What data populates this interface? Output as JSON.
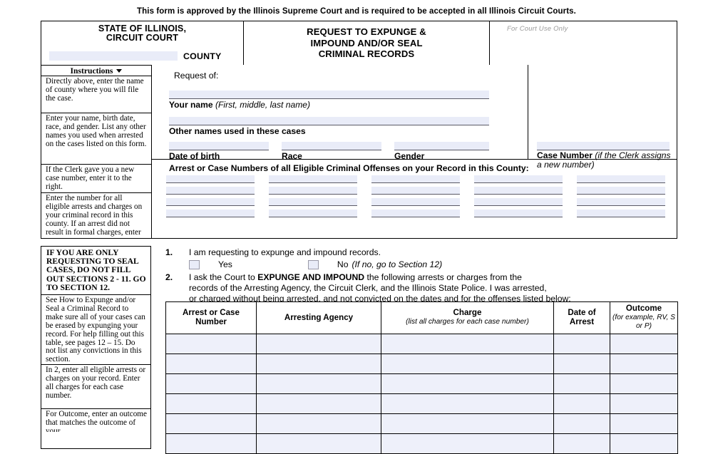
{
  "approval_notice": "This form is approved by the Illinois Supreme Court and is required to be accepted in all Illinois Circuit Courts.",
  "header": {
    "state_line1": "STATE OF ILLINOIS,",
    "state_line2": "CIRCUIT COURT",
    "county_word": "COUNTY",
    "county_value": "",
    "title_line1": "REQUEST TO EXPUNGE &",
    "title_line2": "IMPOUND AND/OR SEAL",
    "title_line3": "CRIMINAL RECORDS",
    "court_use_only": "For Court Use Only"
  },
  "instructions": {
    "heading": "Instructions",
    "items": [
      "Directly above, enter the name of county where you will file the case.",
      "Enter your name, birth date, race, and gender. List any other names you used when arrested on the cases listed on this form.",
      "If the Clerk gave you a new case number, enter it to the right.",
      "Enter the number for all eligible arrests and charges on your criminal record in this county. If an arrest did not result in formal charges, enter the arrest number."
    ]
  },
  "lower_instructions": {
    "warning": "IF YOU ARE ONLY REQUESTING TO SEAL CASES, DO NOT FILL OUT SECTIONS 2 - 11. GO TO SECTION 12.",
    "items": [
      "See How to Expunge and/or Seal a Criminal Record to make sure all of your cases can be erased by expunging your record. For help filling out this table, see pages 12 – 15.  Do not list any convictions in this section.",
      "In 2, enter all eligible arrests or charges on your record. Enter all charges for each case number.",
      "For Outcome, enter an outcome that matches the outcome of your"
    ]
  },
  "fields": {
    "request_of_label": "Request of:",
    "your_name_label": "Your name",
    "your_name_hint": "(First, middle, last name)",
    "your_name_value": "",
    "other_names_label": "Other names used in these cases",
    "other_names_value": "",
    "dob_label": "Date of birth",
    "dob_value": "",
    "race_label": "Race",
    "race_value": "",
    "gender_label": "Gender",
    "gender_value": "",
    "case_number_label": "Case Number",
    "case_number_hint": "(if the Clerk assigns a new number)",
    "case_number_value": ""
  },
  "arrest_numbers": {
    "title": "Arrest or Case Numbers of all Eligible Criminal Offenses on your Record in this County:",
    "columns": 5,
    "rows": 4,
    "values": [
      "",
      "",
      "",
      "",
      "",
      "",
      "",
      "",
      "",
      "",
      "",
      "",
      "",
      "",
      "",
      "",
      "",
      "",
      "",
      ""
    ]
  },
  "section_items": [
    {
      "number": "1.",
      "text": "I am requesting to expunge and impound records.",
      "yes_label": "Yes",
      "no_label": "No",
      "no_hint": "(If no, go to Section 12)",
      "yes_checked": false,
      "no_checked": false
    },
    {
      "number": "2.",
      "line1_a": "I ask the Court to ",
      "line1_b": "EXPUNGE AND IMPOUND",
      "line1_c": " the following arrests or charges from the",
      "line2": "records of the Arresting Agency, the Circuit Clerk, and the Illinois State Police. I was arrested,",
      "line3": "or charged without being arrested, and not convicted on the dates and for the offenses listed below:"
    }
  ],
  "offense_table": {
    "headers": [
      {
        "main": "Arrest or Case Number",
        "sub": ""
      },
      {
        "main": "Arresting Agency",
        "sub": ""
      },
      {
        "main": "Charge",
        "sub": "(list all charges for each case number)"
      },
      {
        "main": "Date of Arrest",
        "sub": ""
      },
      {
        "main": "Outcome",
        "sub": "(for example, RV, S or P)"
      }
    ],
    "rows": [
      [
        "",
        "",
        "",
        "",
        ""
      ],
      [
        "",
        "",
        "",
        "",
        ""
      ],
      [
        "",
        "",
        "",
        "",
        ""
      ],
      [
        "",
        "",
        "",
        "",
        ""
      ],
      [
        "",
        "",
        "",
        "",
        ""
      ],
      [
        "",
        "",
        "",
        "",
        ""
      ]
    ]
  },
  "colors": {
    "field_fill": "#e9ecf8",
    "table_fill": "#eef0fa",
    "border": "#000000",
    "muted_text": "#9a9a9a"
  }
}
